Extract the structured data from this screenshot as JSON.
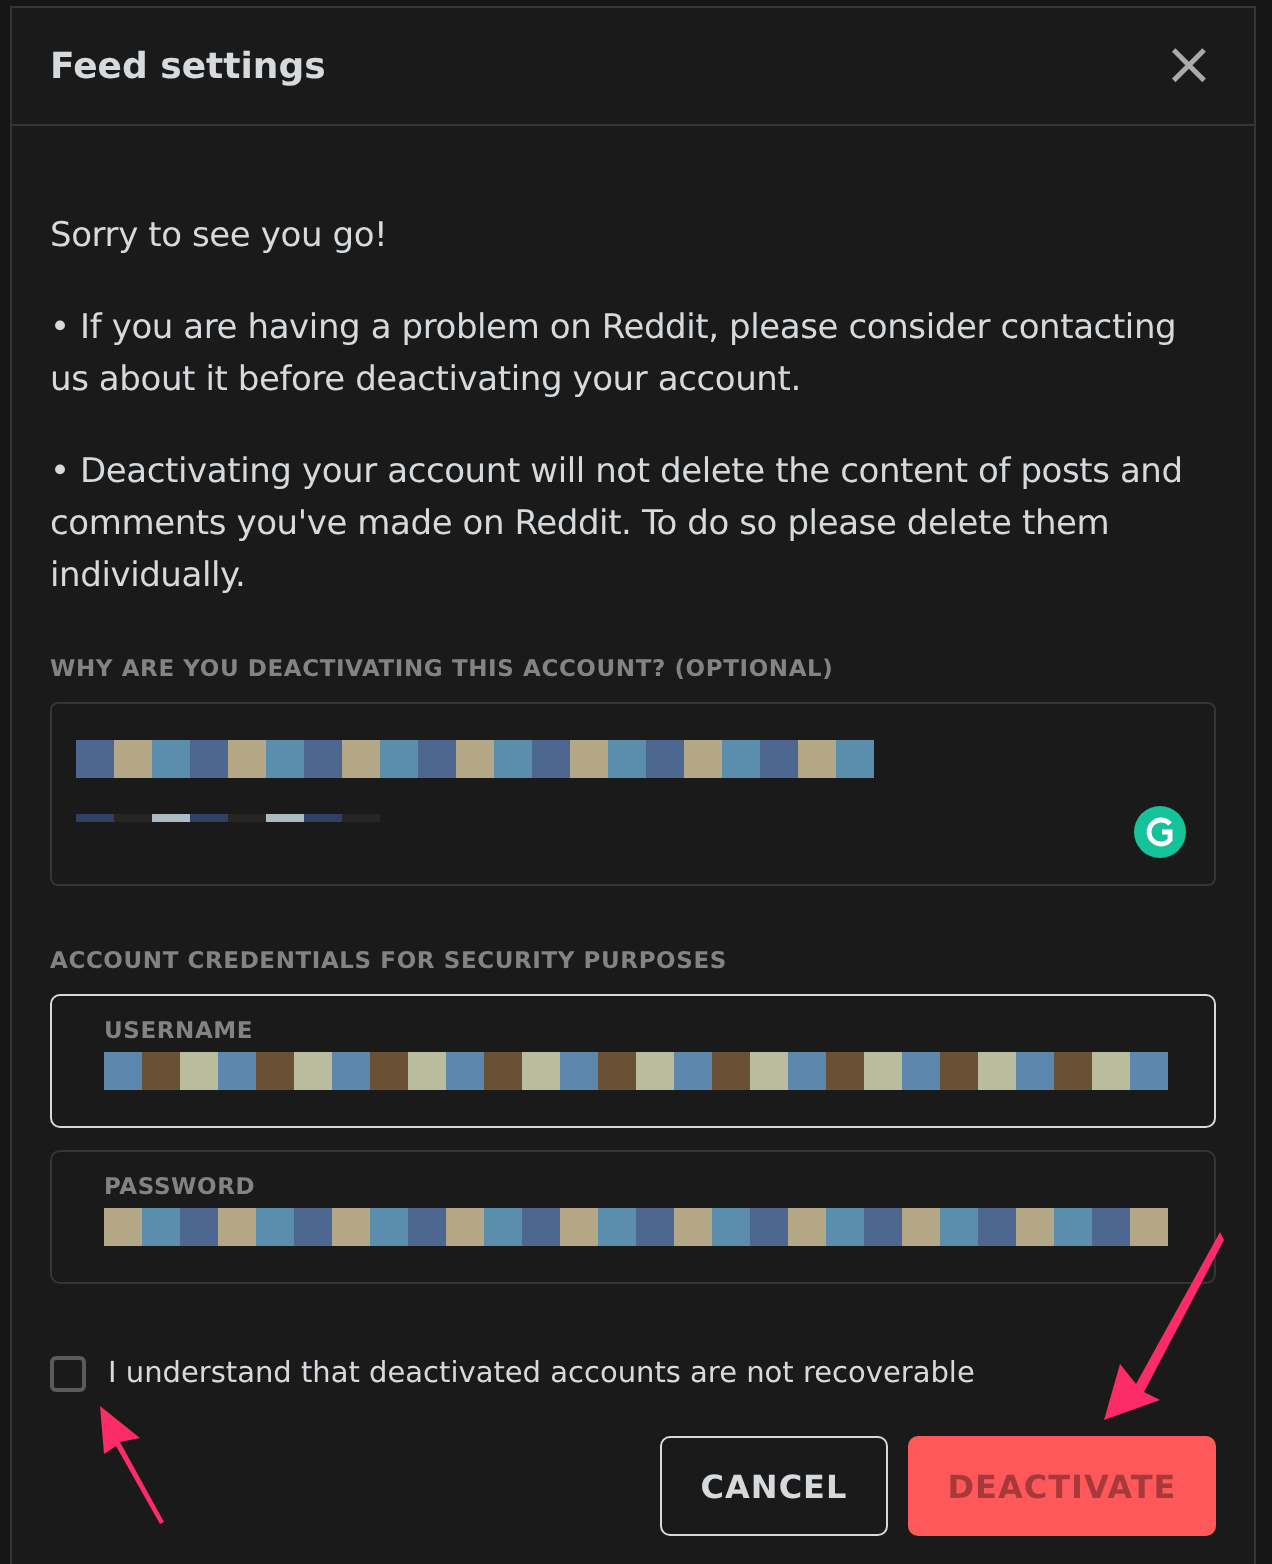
{
  "dialog": {
    "title": "Feed settings",
    "close": "×"
  },
  "intro": "Sorry to see you go!",
  "bullets": [
    "•  If you are having a problem on Reddit, please consider contacting us about it before deactivating your account.",
    "•  Deactivating your account will not delete the content of posts and comments you've made on Reddit. To do so please delete them individually."
  ],
  "reason": {
    "label": "WHY ARE YOU DEACTIVATING THIS ACCOUNT? (OPTIONAL)"
  },
  "credentials": {
    "label": "ACCOUNT CREDENTIALS FOR SECURITY PURPOSES",
    "fields": [
      {
        "label": "USERNAME",
        "focused": true
      },
      {
        "label": "PASSWORD",
        "focused": false
      }
    ]
  },
  "confirm": {
    "label": "I understand that deactivated accounts are not recoverable",
    "checked": false
  },
  "buttons": [
    {
      "kind": "secondary",
      "label": "CANCEL",
      "disabled": false
    },
    {
      "kind": "danger",
      "label": "DEACTIVATE",
      "disabled": true
    }
  ]
}
